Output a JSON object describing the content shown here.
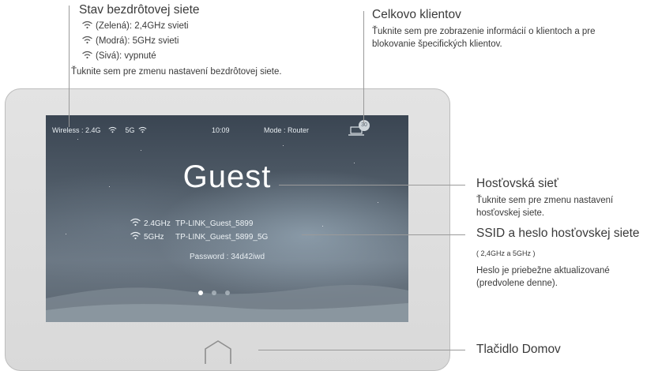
{
  "annotations": {
    "wireless_status": {
      "title": "Stav bezdrôtovej siete",
      "green": "(Zelená): 2,4GHz svieti",
      "blue": "(Modrá): 5GHz svieti",
      "gray": "(Sivá): vypnuté",
      "tap": "Ťuknite sem pre zmenu nastavení bezdrôtovej siete."
    },
    "clients": {
      "title": "Celkovo klientov",
      "description": "Ťuknite sem pre zobrazenie informácií o klientoch a pre blokovanie špecifických klientov."
    },
    "guest_network": {
      "title": "Hosťovská sieť",
      "description": "Ťuknite sem pre zmenu nastavení hosťovskej siete."
    },
    "ssid_password": {
      "title": "SSID a heslo hosťovskej siete",
      "bands": "( 2,4GHz a 5GHz )",
      "description": "Heslo je priebežne aktualizované (predvolene denne)."
    },
    "home_button": {
      "title": "Tlačidlo Domov"
    }
  },
  "screen": {
    "status_bar": {
      "wireless_label": "Wireless : 2.4G",
      "band_5g": "5G",
      "time": "10:09",
      "mode": "Mode : Router",
      "client_count": "30"
    },
    "title": "Guest",
    "networks": [
      {
        "band": "2.4GHz",
        "ssid": "TP-LINK_Guest_5899"
      },
      {
        "band": "5GHz",
        "ssid": "TP-LINK_Guest_5899_5G"
      }
    ],
    "password": "Password : 34d42iwd",
    "page_indicator": {
      "pages": 3,
      "active": 1
    }
  },
  "colors": {
    "line": "#9a9a9a",
    "bezel": "#dcdcdc",
    "screen_top": "#3a4552"
  }
}
